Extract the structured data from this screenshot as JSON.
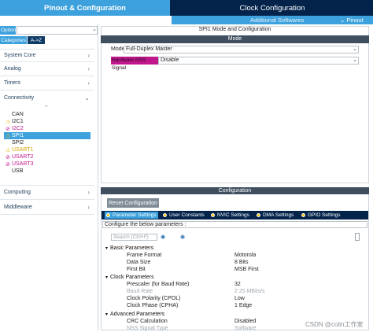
{
  "tabs": {
    "pinout": "Pinout & Configuration",
    "clock": "Clock Configuration"
  },
  "subbar": {
    "additional_software": "Additional Softwares",
    "pinout": "⌄ Pinout"
  },
  "sidebar": {
    "options_label": "Options",
    "tab_categories": "Categories",
    "tab_az": "A->Z",
    "categories": [
      "System Core",
      "Analog",
      "Timers",
      "Connectivity",
      "Computing",
      "Middleware"
    ],
    "peripherals": [
      {
        "name": "CAN",
        "status": "none"
      },
      {
        "name": "I2C1",
        "status": "warning"
      },
      {
        "name": "I2C2",
        "status": "disabled"
      },
      {
        "name": "SPI1",
        "status": "warning-selected"
      },
      {
        "name": "SPI2",
        "status": "none"
      },
      {
        "name": "USART1",
        "status": "warning"
      },
      {
        "name": "USART2",
        "status": "disabled"
      },
      {
        "name": "USART3",
        "status": "disabled"
      },
      {
        "name": "USB",
        "status": "none"
      }
    ]
  },
  "mode_panel": {
    "title": "SPI1 Mode and Configuration",
    "header": "Mode",
    "mode_label": "Mode",
    "mode_value": "Full-Duplex Master",
    "nss_label": "Hardware NSS Signal",
    "nss_value": "Disable"
  },
  "config_panel": {
    "header": "Configuration",
    "reset_button": "Reset Configuration",
    "tabs": [
      "Parameter Settings",
      "User Constants",
      "NVIC Settings",
      "DMA Settings",
      "GPIO Settings"
    ],
    "configure_text": "Configure the below parameters :",
    "search_placeholder": "Search (Ctrl+F)",
    "groups": [
      {
        "name": "Basic Parameters",
        "params": [
          {
            "label": "Frame Format",
            "value": "Motorola"
          },
          {
            "label": "Data Size",
            "value": "8 Bits"
          },
          {
            "label": "First Bit",
            "value": "MSB First"
          }
        ]
      },
      {
        "name": "Clock Parameters",
        "params": [
          {
            "label": "Prescaler (for Baud Rate)",
            "value": "32"
          },
          {
            "label": "Baud Rate",
            "value": "2.25 MBits/s"
          },
          {
            "label": "Clock Polarity (CPOL)",
            "value": "Low"
          },
          {
            "label": "Clock Phase (CPHA)",
            "value": "1 Edge"
          }
        ]
      },
      {
        "name": "Advanced Parameters",
        "params": [
          {
            "label": "CRC Calculation",
            "value": "Disabled"
          },
          {
            "label": "NSS Signal Type",
            "value": "Software"
          }
        ]
      }
    ]
  },
  "watermark": "CSDN @colin工作室",
  "colors": {
    "accent": "#3ca1dc",
    "navy": "#03234b",
    "header": "#3f4f5f",
    "warning": "#f6c900",
    "disabled": "#c0168c",
    "highlight": "#c0168c"
  }
}
